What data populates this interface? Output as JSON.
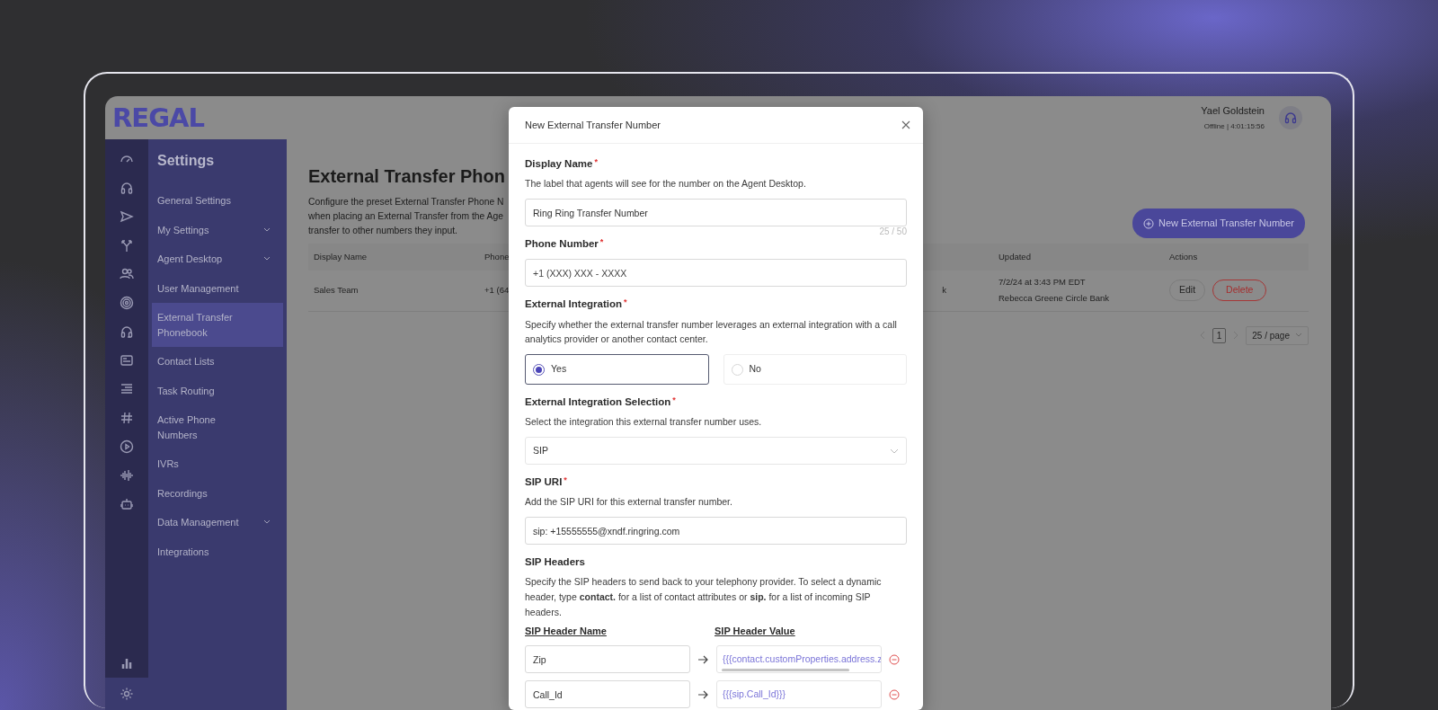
{
  "header": {
    "logo": "REGAL",
    "user_name": "Yael Goldstein",
    "user_status": "Offline | 4:01:15:56"
  },
  "rail": {
    "top": [
      {
        "selected": false
      },
      {
        "selected": false
      },
      {
        "selected": false
      },
      {
        "selected": false
      },
      {
        "selected": false
      },
      {
        "selected": false
      },
      {
        "selected": false
      },
      {
        "selected": false
      },
      {
        "selected": false
      },
      {
        "selected": false
      },
      {
        "selected": false
      },
      {
        "selected": false
      },
      {
        "selected": false
      }
    ],
    "bottom": [
      {
        "selected": false
      },
      {
        "selected": true
      }
    ]
  },
  "sidebar": {
    "title": "Settings",
    "items": [
      {
        "label": "General Settings",
        "expandable": false,
        "selected": false
      },
      {
        "label": "My Settings",
        "expandable": true,
        "selected": false
      },
      {
        "label": "Agent Desktop",
        "expandable": true,
        "selected": false
      },
      {
        "label": "User Management",
        "expandable": false,
        "selected": false
      },
      {
        "label": "External Transfer Phonebook",
        "expandable": false,
        "selected": true
      },
      {
        "label": "Contact Lists",
        "expandable": false,
        "selected": false
      },
      {
        "label": "Task Routing",
        "expandable": false,
        "selected": false
      },
      {
        "label": "Active Phone Numbers",
        "expandable": false,
        "selected": false
      },
      {
        "label": "IVRs",
        "expandable": false,
        "selected": false
      },
      {
        "label": "Recordings",
        "expandable": false,
        "selected": false
      },
      {
        "label": "Data Management",
        "expandable": true,
        "selected": false
      },
      {
        "label": "Integrations",
        "expandable": false,
        "selected": false
      }
    ]
  },
  "page": {
    "title": "External Transfer Phon",
    "description_lines": [
      "Configure the preset External Transfer Phone N",
      "when placing an External Transfer from the Age",
      "transfer to other numbers they input."
    ],
    "new_button": "New External Transfer Number",
    "table": {
      "columns": [
        "Display Name",
        "Phone",
        "",
        "Updated",
        "Actions"
      ],
      "rows": [
        {
          "display_name": "Sales Team",
          "phone": "+1 (64",
          "column_3": "k",
          "updated": "7/2/24 at 3:43 PM EDT",
          "updated_by": "Rebecca Greene Circle Bank",
          "edit": "Edit",
          "delete": "Delete"
        }
      ]
    },
    "pagination": {
      "pages": [
        {
          "label": "1",
          "selected": true
        }
      ],
      "page_size": "25 / page"
    }
  },
  "modal": {
    "title": "New External Transfer Number",
    "fields": [
      {
        "kind": "text",
        "label": "Display Name",
        "required_mark": "*",
        "description": "The label that agents will see for the number on the Agent Desktop.",
        "value": "Ring Ring Transfer Number",
        "counter": "25 / 50"
      },
      {
        "kind": "text",
        "label": "Phone Number",
        "required_mark": "*",
        "placeholder": "+1 (XXX) XXX - XXXX"
      },
      {
        "kind": "radio",
        "label": "External Integration",
        "required_mark": "*",
        "description": "Specify whether the external transfer number leverages an external integration with a call analytics provider or another contact center.",
        "options": [
          {
            "label": "Yes",
            "selected": true
          },
          {
            "label": "No",
            "selected": false
          }
        ]
      },
      {
        "kind": "select",
        "label": "External Integration Selection",
        "required_mark": "*",
        "description": "Select the integration this external transfer number uses.",
        "value": "SIP"
      },
      {
        "kind": "text",
        "label": "SIP URI",
        "required_mark": "*",
        "description": "Add the SIP URI for this external transfer number.",
        "value": "sip: +15555555@xndf.ringring.com"
      },
      {
        "kind": "headers",
        "label": "SIP Headers",
        "description": "Specify the SIP headers to send back to your telephony provider. To select a dynamic header, type **contact.** for a list of contact attributes or **sip.** for a list of incoming SIP headers.",
        "name_heading": "SIP Header Name",
        "value_heading": "SIP Header Value",
        "rows": [
          {
            "name": "Zip",
            "value": "{{{contact.customProperties.address.z",
            "scrollbar": true
          },
          {
            "name": "Call_Id",
            "value": "{{{sip.Call_Id}}}",
            "scrollbar": false
          }
        ]
      }
    ]
  }
}
